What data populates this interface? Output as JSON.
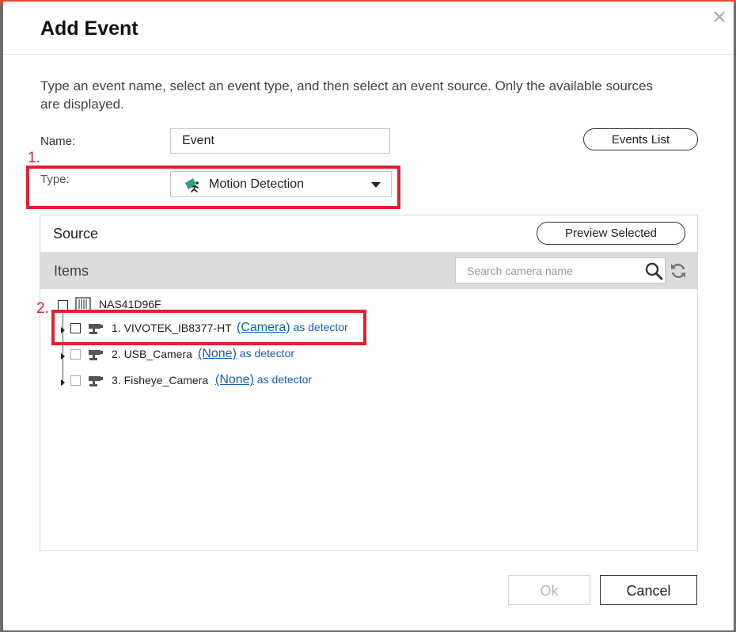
{
  "dialog": {
    "title": "Add Event",
    "description": "Type an event name, select an event type, and then select an event source. Only the available sources are displayed."
  },
  "form": {
    "name_label": "Name:",
    "name_value": "Event",
    "type_label": "Type:",
    "type_value": "Motion Detection",
    "events_list_label": "Events List"
  },
  "annotations": [
    "1.",
    "2."
  ],
  "source": {
    "title": "Source",
    "preview_label": "Preview Selected",
    "items_title": "Items",
    "search_placeholder": "Search camera name",
    "root": "NAS41D96F",
    "cameras": [
      {
        "name": "1. VIVOTEK_IB8377-HT",
        "link": "(Camera)",
        "suffix": "as detector"
      },
      {
        "name": "2. USB_Camera",
        "link": "(None)",
        "suffix": "as detector"
      },
      {
        "name": "3. Fisheye_Camera",
        "link": "(None)",
        "suffix": "as detector"
      }
    ]
  },
  "footer": {
    "ok_label": "Ok",
    "cancel_label": "Cancel"
  },
  "colors": {
    "annotation": "#e0202f",
    "link": "#1561b0",
    "items_bar": "#dcdcdc",
    "motion_icon": "#2e9f86"
  },
  "icons": [
    "close-icon",
    "motion-detection-icon",
    "caret-down-icon",
    "search-icon",
    "refresh-icon",
    "nas-server-icon",
    "camera-icon"
  ]
}
